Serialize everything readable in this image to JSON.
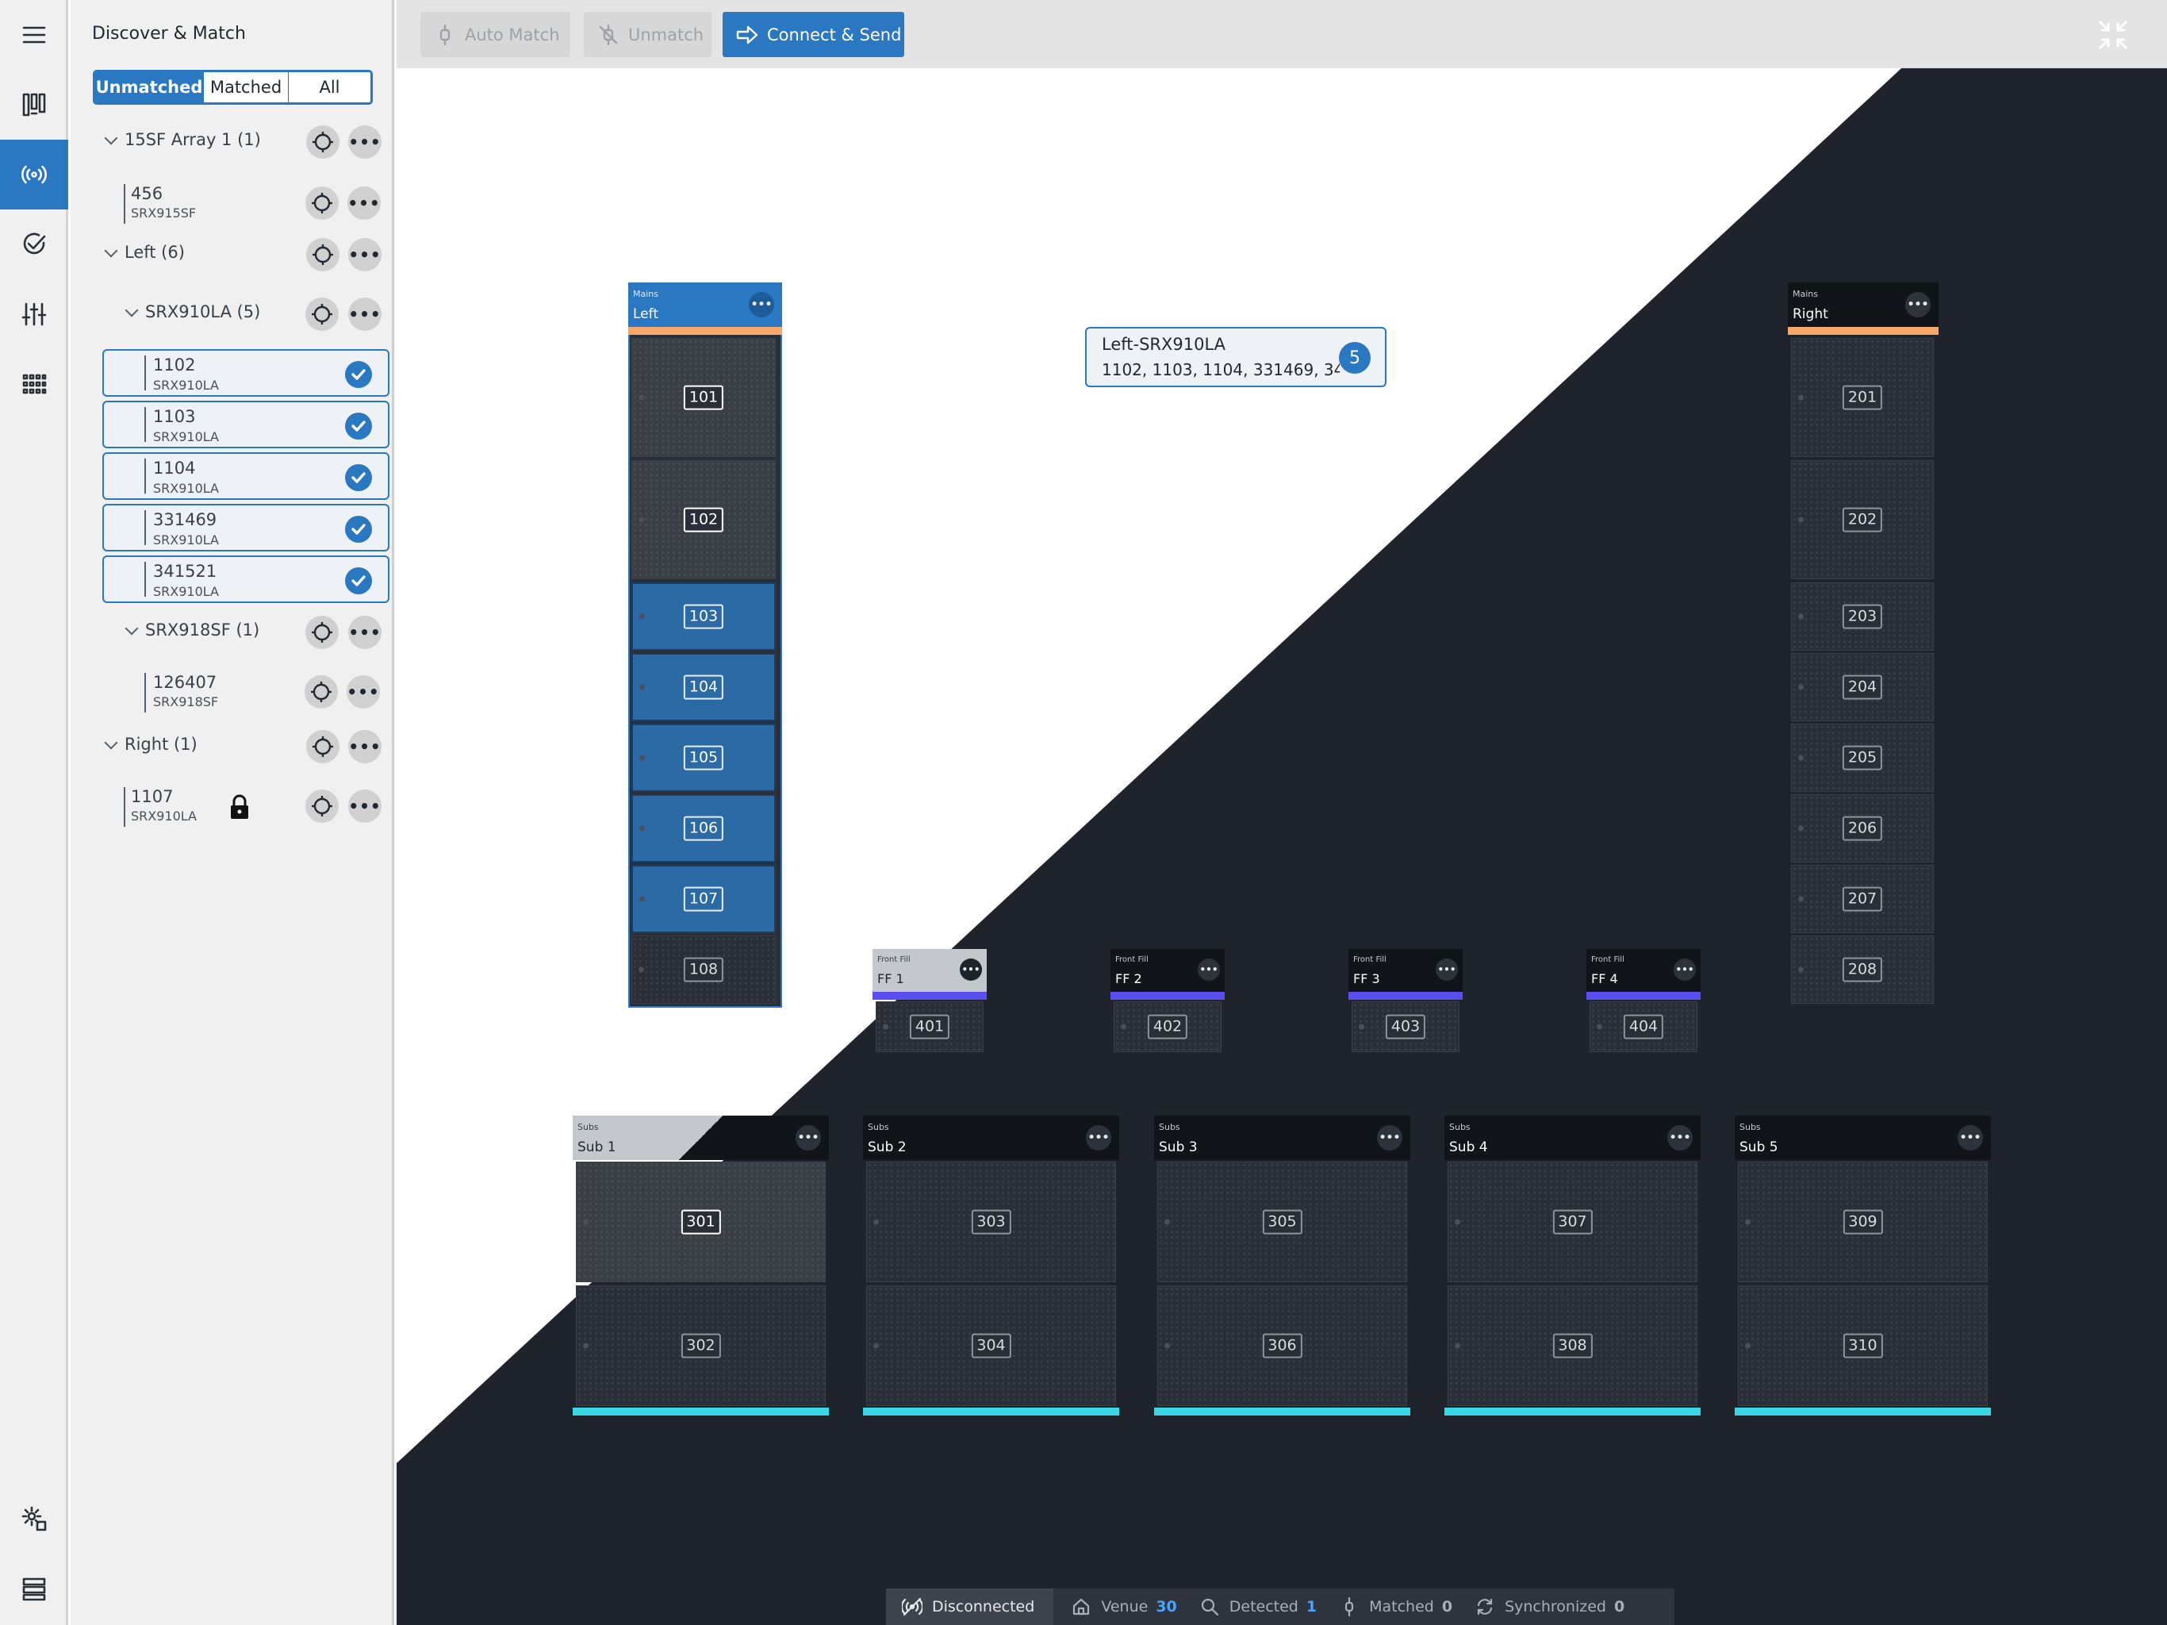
{
  "rail": {
    "items": [
      {
        "name": "menu-icon",
        "active": false
      },
      {
        "name": "arrays-icon",
        "active": false
      },
      {
        "name": "discover-icon",
        "active": true
      },
      {
        "name": "check-icon",
        "active": false
      },
      {
        "name": "tuning-icon",
        "active": false
      },
      {
        "name": "grid-icon",
        "active": false
      },
      {
        "name": "settings-icon",
        "active": false
      },
      {
        "name": "list-icon",
        "active": false
      }
    ]
  },
  "panel": {
    "title": "Discover & Match",
    "filters": [
      "Unmatched",
      "Matched",
      "All"
    ],
    "active_filter": "Unmatched",
    "tree": [
      {
        "kind": "group",
        "label": "15SF Array 1 (1)",
        "level": 0
      },
      {
        "kind": "device",
        "id": "456",
        "model": "SRX915SF",
        "level": 0,
        "selected": false,
        "locked": false
      },
      {
        "kind": "group",
        "label": "Left (6)",
        "level": 0
      },
      {
        "kind": "group",
        "label": "SRX910LA (5)",
        "level": 1
      },
      {
        "kind": "device",
        "id": "1102",
        "model": "SRX910LA",
        "level": 1,
        "selected": true
      },
      {
        "kind": "device",
        "id": "1103",
        "model": "SRX910LA",
        "level": 1,
        "selected": true
      },
      {
        "kind": "device",
        "id": "1104",
        "model": "SRX910LA",
        "level": 1,
        "selected": true
      },
      {
        "kind": "device",
        "id": "331469",
        "model": "SRX910LA",
        "level": 1,
        "selected": true
      },
      {
        "kind": "device",
        "id": "341521",
        "model": "SRX910LA",
        "level": 1,
        "selected": true
      },
      {
        "kind": "group",
        "label": "SRX918SF (1)",
        "level": 1
      },
      {
        "kind": "device",
        "id": "126407",
        "model": "SRX918SF",
        "level": 1,
        "selected": false,
        "locked": false
      },
      {
        "kind": "group",
        "label": "Right (1)",
        "level": 0
      },
      {
        "kind": "device",
        "id": "1107",
        "model": "SRX910LA",
        "level": 0,
        "selected": false,
        "locked": true
      }
    ]
  },
  "toolbar": {
    "auto_match": "Auto Match",
    "unmatch": "Unmatch",
    "connect_send": "Connect & Send"
  },
  "tooltip": {
    "title": "Left-SRX910LA",
    "ids": "1102, 1103, 1104, 331469, 34",
    "count": "5"
  },
  "arrays": {
    "left": {
      "category": "Mains",
      "name": "Left",
      "strip_color": "#f5a86a",
      "cabinets": [
        "101",
        "102",
        "103",
        "104",
        "105",
        "106",
        "107",
        "108"
      ],
      "selected": [
        "103",
        "104",
        "105",
        "106",
        "107"
      ]
    },
    "right": {
      "category": "Mains",
      "name": "Right",
      "strip_color": "#f5a86a",
      "cabinets": [
        "201",
        "202",
        "203",
        "204",
        "205",
        "206",
        "207",
        "208"
      ]
    },
    "front_fills": [
      {
        "category": "Front Fill",
        "name": "FF 1",
        "cabinet": "401"
      },
      {
        "category": "Front Fill",
        "name": "FF 2",
        "cabinet": "402"
      },
      {
        "category": "Front Fill",
        "name": "FF 3",
        "cabinet": "403"
      },
      {
        "category": "Front Fill",
        "name": "FF 4",
        "cabinet": "404"
      }
    ],
    "front_fill_color": "#5b4df0",
    "subs": [
      {
        "category": "Subs",
        "name": "Sub 1",
        "cabinets": [
          "301",
          "302"
        ]
      },
      {
        "category": "Subs",
        "name": "Sub 2",
        "cabinets": [
          "303",
          "304"
        ]
      },
      {
        "category": "Subs",
        "name": "Sub 3",
        "cabinets": [
          "305",
          "306"
        ]
      },
      {
        "category": "Subs",
        "name": "Sub 4",
        "cabinets": [
          "307",
          "308"
        ]
      },
      {
        "category": "Subs",
        "name": "Sub 5",
        "cabinets": [
          "309",
          "310"
        ]
      }
    ],
    "subs_color": "#3ad8e6"
  },
  "status": {
    "connection": "Disconnected",
    "venue_label": "Venue",
    "venue_count": "30",
    "detected_label": "Detected",
    "detected_count": "1",
    "matched_label": "Matched",
    "matched_count": "0",
    "synchronized_label": "Synchronized",
    "synchronized_count": "0"
  },
  "colors": {
    "accent": "#2a77c2",
    "canvas_dark": "#1f242c",
    "selected_cabinet": "#2c6aa6"
  }
}
